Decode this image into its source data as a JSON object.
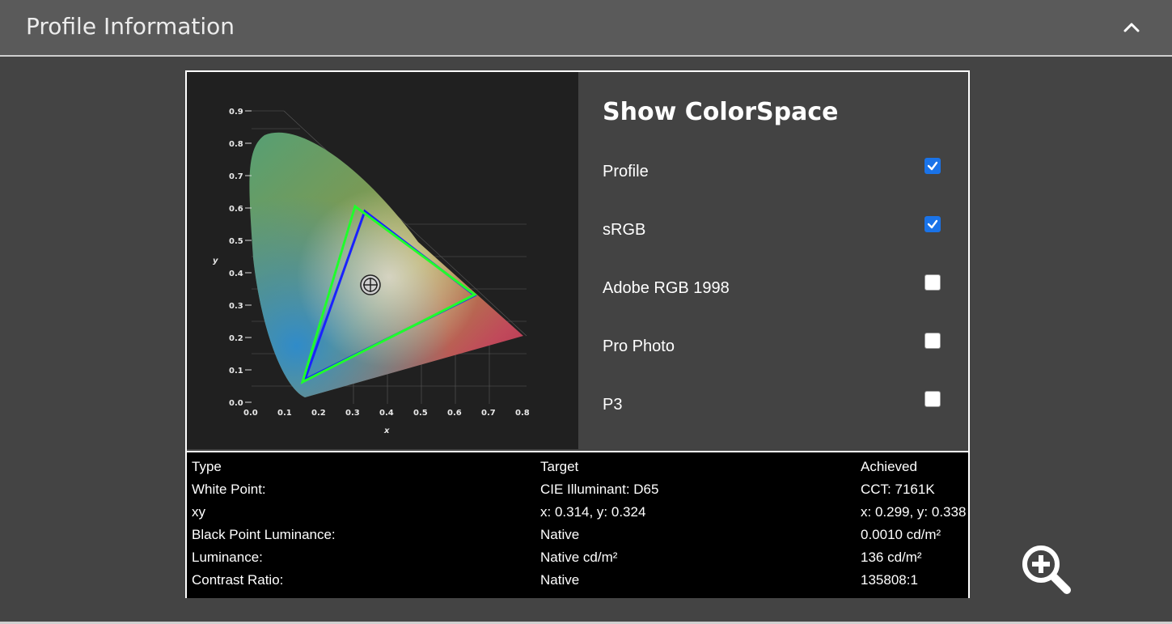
{
  "header": {
    "title": "Profile Information",
    "collapse_icon": "chevron-up-icon"
  },
  "diagram": {
    "y_ticks": [
      "0.9",
      "0.8",
      "0.7",
      "0.6",
      "0.5",
      "0.4",
      "0.3",
      "0.2",
      "0.1",
      "0.0"
    ],
    "x_ticks": [
      "0.0",
      "0.1",
      "0.2",
      "0.3",
      "0.4",
      "0.5",
      "0.6",
      "0.7",
      "0.8"
    ],
    "x_label": "x",
    "y_label": "y",
    "white_point_icon": "crosshair-icon",
    "colors": {
      "profile": "#1fff2b",
      "srgb": "#1a22ff"
    }
  },
  "colorspace": {
    "title": "Show ColorSpace",
    "options": [
      {
        "label": "Profile",
        "checked": true
      },
      {
        "label": "sRGB",
        "checked": true
      },
      {
        "label": "Adobe RGB 1998",
        "checked": false
      },
      {
        "label": "Pro Photo",
        "checked": false
      },
      {
        "label": "P3",
        "checked": false
      }
    ]
  },
  "table": {
    "headers": [
      "Type",
      "Target",
      "Achieved"
    ],
    "rows": [
      [
        "White Point:",
        "CIE Illuminant: D65",
        "CCT: 7161K"
      ],
      [
        "xy",
        "x: 0.314, y: 0.324",
        "x: 0.299, y: 0.338"
      ],
      [
        "Black Point Luminance:",
        "Native",
        "0.0010 cd/m²"
      ],
      [
        "Luminance:",
        "Native cd/m²",
        "136 cd/m²"
      ],
      [
        "Contrast Ratio:",
        "Native",
        "135808:1"
      ]
    ]
  },
  "zoom": {
    "icon": "zoom-in-icon"
  }
}
